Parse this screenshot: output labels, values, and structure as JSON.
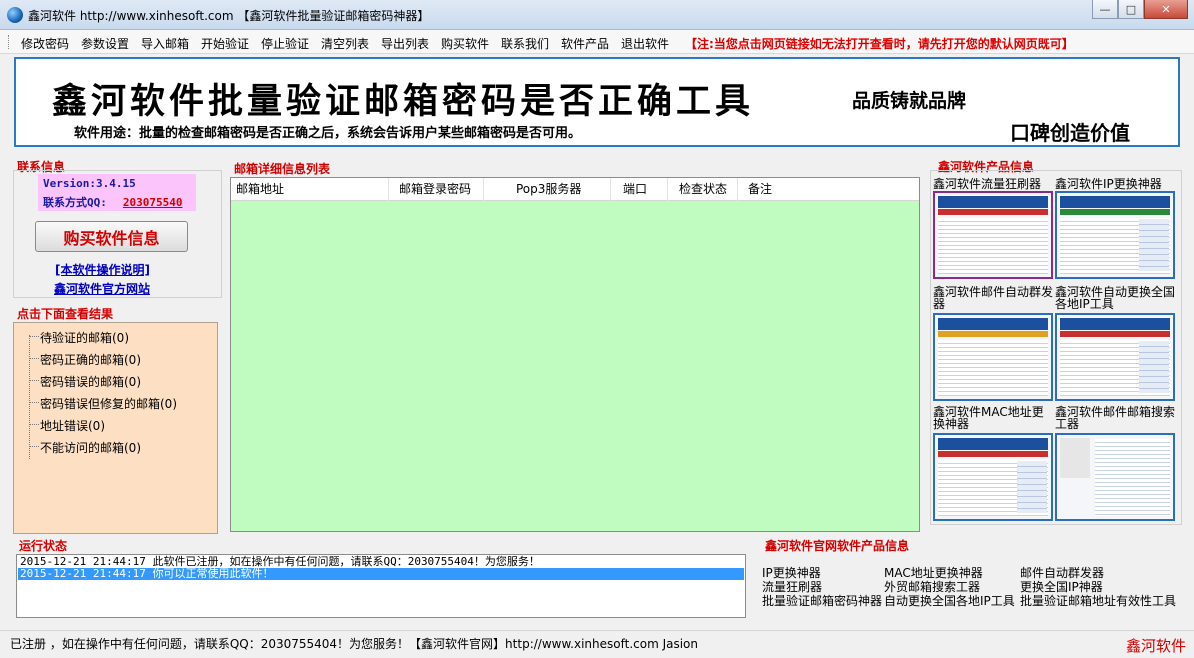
{
  "window": {
    "title": "鑫河软件 http://www.xinhesoft.com 【鑫河软件批量验证邮箱密码神器】"
  },
  "menu": {
    "items": [
      "修改密码",
      "参数设置",
      "导入邮箱",
      "开始验证",
      "停止验证",
      "清空列表",
      "导出列表",
      "购买软件",
      "联系我们",
      "软件产品",
      "退出软件"
    ],
    "note": "【注:当您点击网页链接如无法打开查看时，请先打开您的默认网页既可】"
  },
  "banner": {
    "title": "鑫河软件批量验证邮箱密码是否正确工具",
    "usage": "软件用途：批量的检查邮箱密码是否正确之后，系统会告诉用户某些邮箱密码是否可用。",
    "slogan1": "品质铸就品牌",
    "slogan2": "口碑创造价值"
  },
  "contact": {
    "section_title": "联系信息",
    "version": "Version:3.4.15",
    "qq_label": "联系方式QQ:",
    "qq": "203075540",
    "buy_button": "购买软件信息",
    "manual_link": "[本软件操作说明]",
    "site_link": "鑫河软件官方网站"
  },
  "results": {
    "section_title": "点击下面查看结果",
    "items": [
      "待验证的邮箱(0)",
      "密码正确的邮箱(0)",
      "密码错误的邮箱(0)",
      "密码错误但修复的邮箱(0)",
      "地址错误(0)",
      "不能访问的邮箱(0)"
    ]
  },
  "mail_list": {
    "section_title": "邮箱详细信息列表",
    "columns": [
      "邮箱地址",
      "邮箱登录密码",
      "Pop3服务器",
      "端口",
      "检查状态",
      "备注"
    ],
    "rows": []
  },
  "products": {
    "section_title": "鑫河软件产品信息",
    "items": [
      {
        "label": "鑫河软件流量狂刷器",
        "icon": "traffic-refresher-thumbnail"
      },
      {
        "label": "鑫河软件IP更换神器",
        "icon": "ip-changer-thumbnail"
      },
      {
        "label": "鑫河软件邮件自动群发器",
        "icon": "mass-mailer-thumbnail"
      },
      {
        "label": "鑫河软件自动更换全国各地IP工具",
        "icon": "auto-ip-changer-thumbnail"
      },
      {
        "label": "鑫河软件MAC地址更换神器",
        "icon": "mac-changer-thumbnail"
      },
      {
        "label": "鑫河软件邮件邮箱搜索工器",
        "icon": "mail-search-thumbnail"
      }
    ]
  },
  "run_status": {
    "section_title": "运行状态",
    "log": [
      {
        "text": "2015-12-21 21:44:17 此软件已注册，如在操作中有任何问题，请联系QQ：2030755404！为您服务！",
        "selected": false
      },
      {
        "text": "2015-12-21 21:44:17 你可以正常使用此软件！",
        "selected": true
      }
    ]
  },
  "web_products": {
    "section_title": "鑫河软件官网软件产品信息",
    "col1": [
      "IP更换神器",
      "流量狂刷器",
      "批量验证邮箱密码神器"
    ],
    "col2": [
      "MAC地址更换神器",
      "外贸邮箱搜索工器",
      "自动更换全国各地IP工具"
    ],
    "col3": [
      "邮件自动群发器",
      "更换全国IP神器",
      "批量验证邮箱地址有效性工具"
    ]
  },
  "statusbar": {
    "text": "已注册 ，如在操作中有任何问题，请联系QQ：2030755404！为您服务！【鑫河软件官网】http://www.xinhesoft.com    Jasion",
    "brand": "鑫河软件"
  },
  "colors": {
    "accent_red": "#d40000",
    "list_bg": "#c0fcc0",
    "results_bg": "#fde0c4",
    "version_bg": "#fbc4fb",
    "banner_border": "#2a78c6"
  }
}
